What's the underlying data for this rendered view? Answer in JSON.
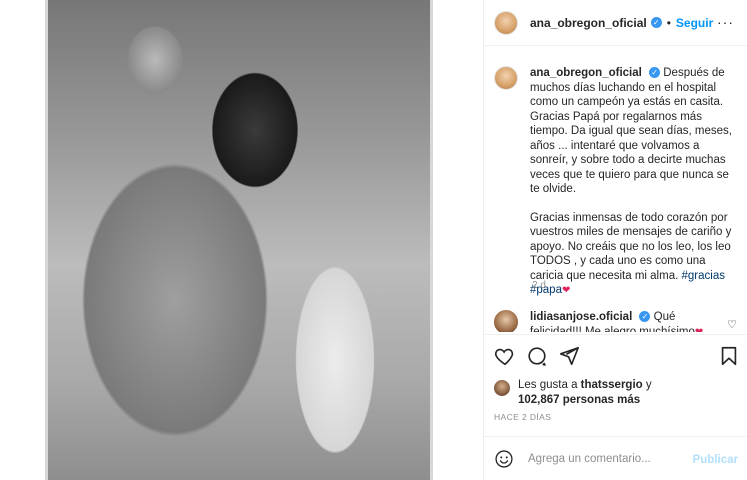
{
  "post": {
    "username": "ana_obregon_oficial",
    "follow_label": "Seguir",
    "more_label": "···",
    "caption_username": "ana_obregon_oficial",
    "caption_p1": "Después de muchos días luchando en el hospital como un campeón ya estás en casita. Gracias Papá por regalarnos más tiempo. Da igual que sean días, meses, años ... intentaré que volvamos a sonreír, y sobre todo a decirte muchas veces que te quiero para que nunca se te olvide.",
    "caption_p2": "Gracias inmensas de todo corazón por vuestros miles de mensajes de cariño y apoyo. No creáis que no los leo, los leo TODOS , y cada uno es como una caricia que necesita mi alma.",
    "tags": [
      "#gracias",
      "#papa"
    ],
    "caption_emoji": "❤",
    "time_ago": "2 d"
  },
  "comment": {
    "username": "lidiasanjose.oficial",
    "text": "Qué felicidad!!! Me alegro muchísimo",
    "emoji": "❤"
  },
  "likes": {
    "prefix": "Les gusta a",
    "user": "thatssergio",
    "joiner": "y",
    "count": "102,867 personas más"
  },
  "date": "HACE 2 DÍAS",
  "add_comment": {
    "placeholder": "Agrega un comentario...",
    "publish_label": "Publicar"
  },
  "icons": [
    "heart-icon",
    "comment-icon",
    "share-icon",
    "bookmark-icon",
    "emoji-icon",
    "verified-icon"
  ],
  "colors": {
    "accent": "#0095f6",
    "link": "#00376b",
    "muted": "#8e8e8e",
    "verified": "#3897f0"
  }
}
